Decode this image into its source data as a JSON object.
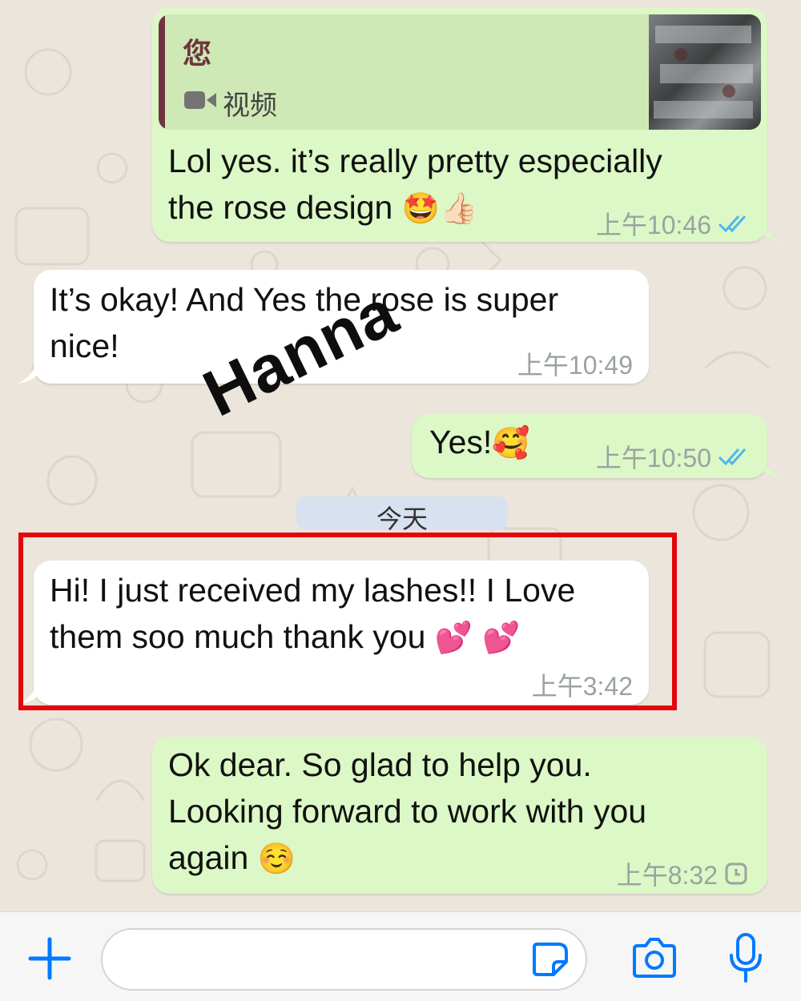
{
  "quoted": {
    "sender": "您",
    "media_label": "视频"
  },
  "messages": [
    {
      "id": "m1",
      "direction": "outgoing",
      "text_line1": "Lol yes. it’s really pretty especially",
      "text_line2": "the rose design",
      "emoji": "🤩👍🏻",
      "time": "上午10:46",
      "status": "read"
    },
    {
      "id": "m2",
      "direction": "incoming",
      "text_line1": "It’s okay! And Yes the rose is super",
      "text_line2": "nice!",
      "time": "上午10:49"
    },
    {
      "id": "m3",
      "direction": "outgoing",
      "text_line1": "Yes!",
      "emoji": "🥰",
      "time": "上午10:50",
      "status": "read"
    },
    {
      "id": "m4",
      "direction": "incoming",
      "text_line1": "Hi! I just received my lashes!! I Love",
      "text_line2": "them soo much thank you",
      "emoji": "💕 💕",
      "time": "上午3:42"
    },
    {
      "id": "m5",
      "direction": "outgoing",
      "text_line1": "Ok dear. So glad to help you.",
      "text_line2": "Looking forward to work with you",
      "text_line3": "again",
      "emoji": "☺️",
      "time": "上午8:32",
      "status": "pending"
    }
  ],
  "day_separator": "今天",
  "watermark": "Hanna",
  "composer": {
    "icons": [
      "plus-icon",
      "sticker-icon",
      "camera-icon",
      "microphone-icon"
    ]
  },
  "colors": {
    "outgoing_bubble": "#dcf8c6",
    "incoming_bubble": "#ffffff",
    "read_ticks": "#4fb6ec",
    "accent": "#007aff",
    "highlight": "#e3060c",
    "quote_bar": "#6e3540"
  }
}
